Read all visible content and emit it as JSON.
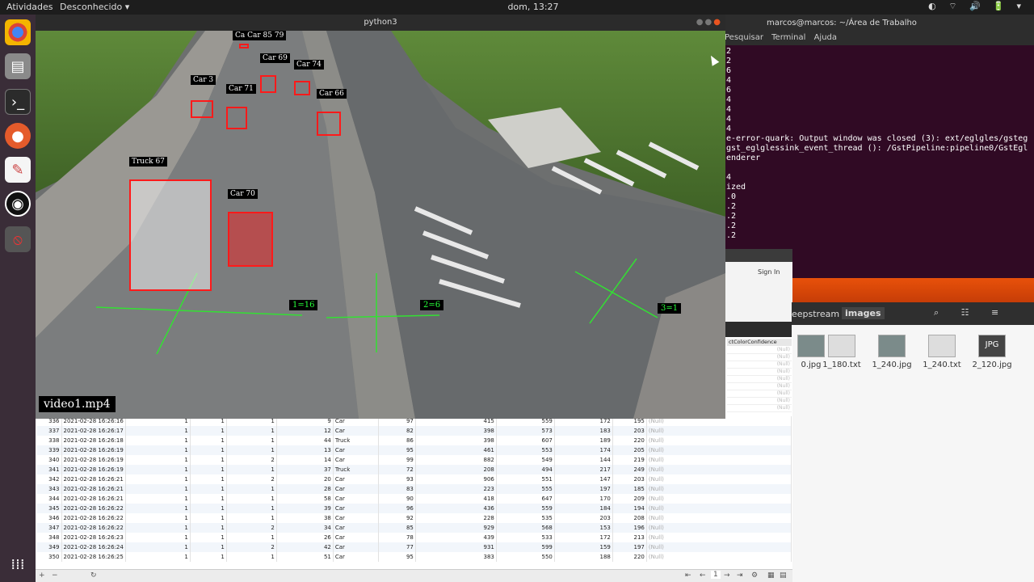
{
  "topbar": {
    "activities": "Atividades",
    "app": "Desconhecido ▾",
    "clock": "dom, 13:27",
    "tray": "◐ ⌔ 🔊 🔋 ▾"
  },
  "video": {
    "title": "python3",
    "filename": "video1.mp4",
    "detections": [
      {
        "label": "Ca Car 85 79"
      },
      {
        "label": "Car 69"
      },
      {
        "label": "Car 74"
      },
      {
        "label": "Car 3"
      },
      {
        "label": "Car 71"
      },
      {
        "label": "Car 66"
      },
      {
        "label": "Truck 67"
      },
      {
        "label": "Car 70"
      }
    ],
    "counters": [
      {
        "text": "1=16"
      },
      {
        "text": "2=6"
      },
      {
        "text": "3=1"
      }
    ]
  },
  "terminal": {
    "title": "marcos@marcos: ~/Área de Trabalho",
    "menu": [
      "Pesquisar",
      "Terminal",
      "Ajuda"
    ],
    "lines": "2\n2\n6\n4\n6\n4\n4\n4\n4\ne-error-quark: Output window was closed (3): ext/eglgles/gsteg\ngst_eglglessink_event_thread (): /GstPipeline:pipeline0/GstEgl\nenderer\n\n4\nized\n.0\n.2\n.2\n.2\n.2"
  },
  "browser": {
    "sign_in": "Sign In"
  },
  "files": {
    "crumb1": "eepstream",
    "crumb2": "images",
    "items": [
      {
        "name": "0.jpg",
        "type": "thumb"
      },
      {
        "name": "1_180.txt",
        "type": "txt"
      },
      {
        "name": "1_240.jpg",
        "type": "thumb"
      },
      {
        "name": "1_240.txt",
        "type": "txt"
      },
      {
        "name": "2_120.jpg",
        "type": "jpg",
        "badge": "JPG"
      }
    ]
  },
  "db": {
    "column_header": "ctColorConfidence",
    "null_text": "(Null)",
    "rows": [
      [
        "336",
        "2021-02-28 16:26:16",
        "1",
        "1",
        "1",
        "9",
        "Car",
        "97",
        "415",
        "559",
        "172",
        "195"
      ],
      [
        "337",
        "2021-02-28 16:26:17",
        "1",
        "1",
        "1",
        "12",
        "Car",
        "82",
        "398",
        "573",
        "183",
        "203"
      ],
      [
        "338",
        "2021-02-28 16:26:18",
        "1",
        "1",
        "1",
        "44",
        "Truck",
        "86",
        "398",
        "607",
        "189",
        "220"
      ],
      [
        "339",
        "2021-02-28 16:26:19",
        "1",
        "1",
        "1",
        "13",
        "Car",
        "95",
        "461",
        "553",
        "174",
        "205"
      ],
      [
        "340",
        "2021-02-28 16:26:19",
        "1",
        "1",
        "2",
        "14",
        "Car",
        "99",
        "882",
        "549",
        "144",
        "219"
      ],
      [
        "341",
        "2021-02-28 16:26:19",
        "1",
        "1",
        "1",
        "37",
        "Truck",
        "72",
        "208",
        "494",
        "217",
        "249"
      ],
      [
        "342",
        "2021-02-28 16:26:21",
        "1",
        "1",
        "2",
        "20",
        "Car",
        "93",
        "906",
        "551",
        "147",
        "203"
      ],
      [
        "343",
        "2021-02-28 16:26:21",
        "1",
        "1",
        "1",
        "28",
        "Car",
        "83",
        "223",
        "555",
        "197",
        "185"
      ],
      [
        "344",
        "2021-02-28 16:26:21",
        "1",
        "1",
        "1",
        "58",
        "Car",
        "90",
        "418",
        "647",
        "170",
        "209"
      ],
      [
        "345",
        "2021-02-28 16:26:22",
        "1",
        "1",
        "1",
        "39",
        "Car",
        "96",
        "436",
        "559",
        "184",
        "194"
      ],
      [
        "346",
        "2021-02-28 16:26:22",
        "1",
        "1",
        "1",
        "38",
        "Car",
        "92",
        "228",
        "535",
        "203",
        "208"
      ],
      [
        "347",
        "2021-02-28 16:26:22",
        "1",
        "1",
        "2",
        "34",
        "Car",
        "85",
        "929",
        "568",
        "153",
        "196"
      ],
      [
        "348",
        "2021-02-28 16:26:23",
        "1",
        "1",
        "1",
        "26",
        "Car",
        "78",
        "439",
        "533",
        "172",
        "213"
      ],
      [
        "349",
        "2021-02-28 16:26:24",
        "1",
        "1",
        "2",
        "42",
        "Car",
        "77",
        "931",
        "599",
        "159",
        "197"
      ],
      [
        "350",
        "2021-02-28 16:26:25",
        "1",
        "1",
        "1",
        "51",
        "Car",
        "95",
        "383",
        "550",
        "188",
        "220"
      ]
    ],
    "page": "1"
  }
}
